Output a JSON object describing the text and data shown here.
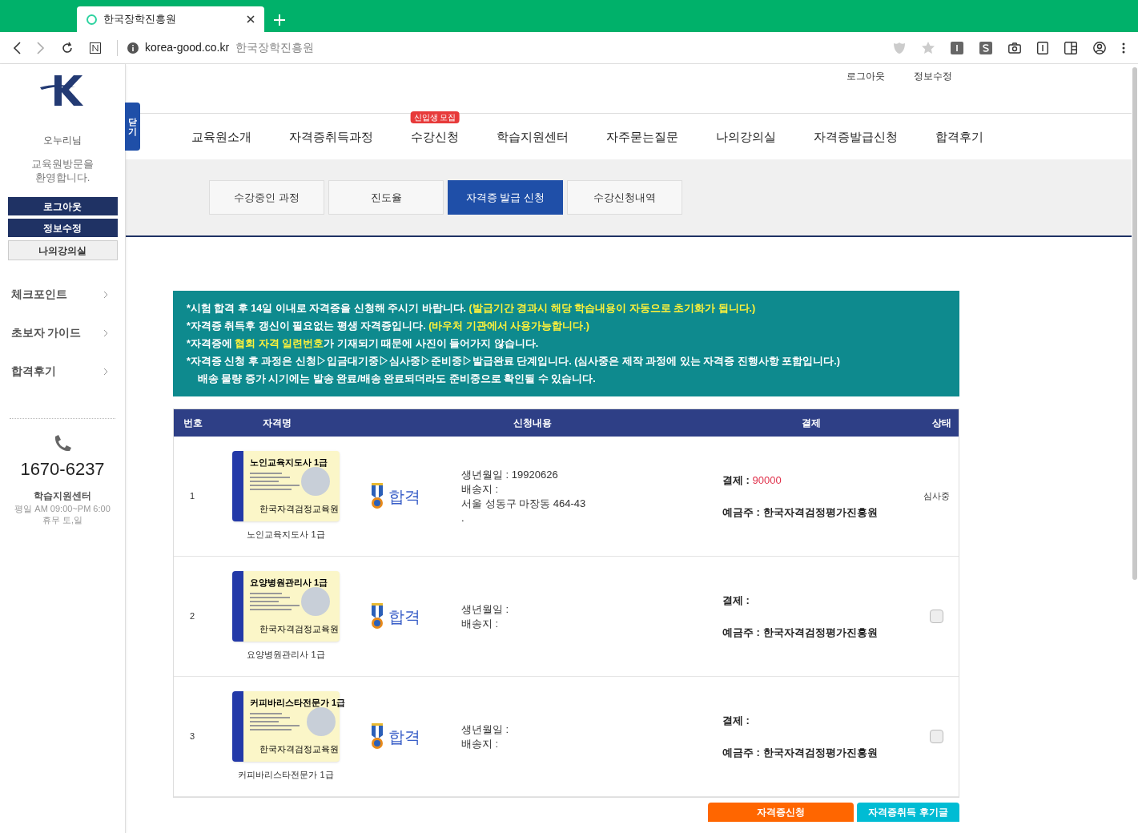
{
  "browser": {
    "tab_title": "한국장학진흥원",
    "url": "korea-good.co.kr",
    "address_title": "한국장학진흥원"
  },
  "header_links": [
    "로그아웃",
    "정보수정"
  ],
  "nav": [
    {
      "label": "교육원소개"
    },
    {
      "label": "자격증취득과정"
    },
    {
      "label": "수강신청",
      "badge": "신입생 모집"
    },
    {
      "label": "학습지원센터"
    },
    {
      "label": "자주묻는질문"
    },
    {
      "label": "나의강의실"
    },
    {
      "label": "자격증발급신청"
    },
    {
      "label": "합격후기"
    }
  ],
  "sidebar": {
    "toggle_label": "닫기",
    "greeting": "오누리님",
    "welcome": "교육원방문을\n환영합니다.",
    "buttons": [
      {
        "label": "로그아웃",
        "kind": "primary"
      },
      {
        "label": "정보수정",
        "kind": "primary"
      },
      {
        "label": "나의강의실",
        "kind": "secondary"
      }
    ],
    "menu": [
      "체크포인트",
      "초보자 가이드",
      "합격후기"
    ],
    "phone": "1670-6237",
    "center": "학습지원센터",
    "hours": [
      "평일 AM 09:00~PM 6:00",
      "휴무 토,일"
    ]
  },
  "subtabs": [
    {
      "label": "수강중인 과정",
      "selected": false
    },
    {
      "label": "진도율",
      "selected": false
    },
    {
      "label": "자격증 발급 신청",
      "selected": true
    },
    {
      "label": "수강신청내역",
      "selected": false
    }
  ],
  "notices": [
    [
      {
        "text": "*시험 합격 후 14일 이내로 자격증을 신청해 주시기 바랍니다. ",
        "highlight": false
      },
      {
        "text": "(발급기간 경과시 해당 학습내용이 자동으로 초기화가 됩니다.)",
        "highlight": true
      }
    ],
    [
      {
        "text": "*자격증 취득후 갱신이 필요없는 평생 자격증입니다. ",
        "highlight": false
      },
      {
        "text": "(바우처 기관에서 사용가능합니다.)",
        "highlight": true
      }
    ],
    [
      {
        "text": "*자격증에 ",
        "highlight": false
      },
      {
        "text": "협회 자격 일련번호",
        "highlight": true
      },
      {
        "text": "가 기재되기 때문에 사진이 들어가지 않습니다.",
        "highlight": false
      }
    ],
    [
      {
        "text": "*자격증 신청 후 과정은 신청▷입금대기중▷심사중▷준비중▷발급완료 단계입니다. (심사중은 제작 과정에 있는 자격증 진행사항 포함입니다.)",
        "highlight": false
      }
    ],
    [
      {
        "text": "배송 물량 증가 시기에는 발송 완료/배송 완료되더라도 준비중으로 확인될 수 있습니다.",
        "highlight": false
      }
    ]
  ],
  "table": {
    "columns": [
      "번호",
      "자격명",
      "신청내용",
      "결제",
      "상태"
    ],
    "rows": [
      {
        "number": "1",
        "card_title": "노인교육지도사 1급",
        "card_org": "한국자격검정교육원",
        "cert_name": "노인교육지도사 1급",
        "result": "합격",
        "details": [
          "생년월일 : 19920626",
          "배송지 :",
          "서울 성동구 마장동 464-43",
          "."
        ],
        "payment_label": "결제 : ",
        "amount": "90000",
        "depositor": "예금주 : 한국자격검정평가진흥원",
        "status": {
          "kind": "text",
          "text": "심사중"
        }
      },
      {
        "number": "2",
        "card_title": "요양병원관리사 1급",
        "card_org": "한국자격검정교육원",
        "cert_name": "요양병원관리사 1급",
        "result": "합격",
        "details": [
          "생년월일 :",
          "배송지 :"
        ],
        "payment_label": "결제 :",
        "depositor": "예금주 : 한국자격검정평가진흥원",
        "status": {
          "kind": "checkbox",
          "checked": false
        }
      },
      {
        "number": "3",
        "card_title": "커피바리스타전문가 1급",
        "card_org": "한국자격검정교육원",
        "cert_name": "커피바리스타전문가 1급",
        "result": "합격",
        "details": [
          "생년월일 :",
          "배송지 :"
        ],
        "payment_label": "결제 :",
        "depositor": "예금주 : 한국자격검정평가진흥원",
        "status": {
          "kind": "checkbox",
          "checked": false
        }
      }
    ]
  },
  "bottom_buttons": [
    {
      "label": "자격증신청",
      "kind": "orange"
    },
    {
      "label": "자격증취득 후기글",
      "kind": "cyan"
    }
  ]
}
